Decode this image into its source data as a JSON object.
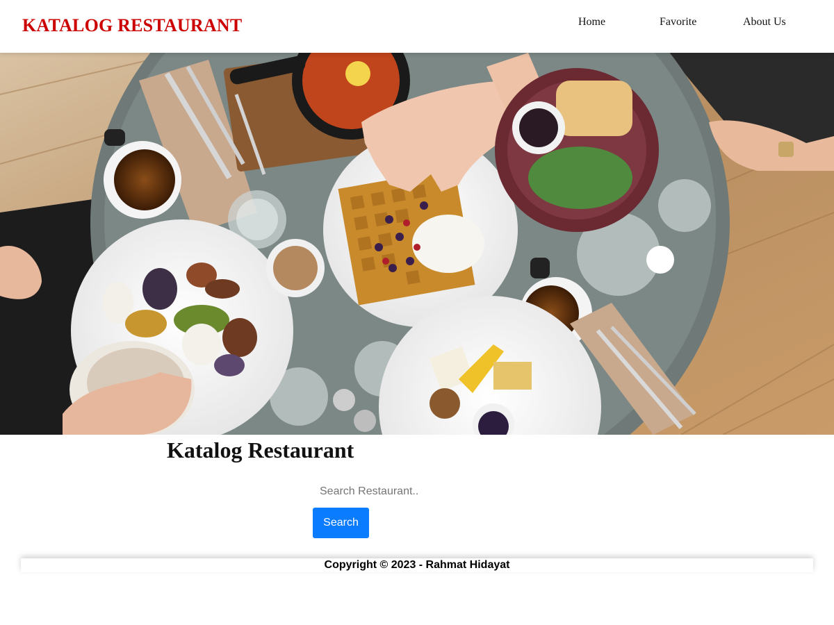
{
  "header": {
    "brand": "KATALOG RESTAURANT",
    "nav": {
      "home": "Home",
      "favorite": "Favorite",
      "about": "About Us"
    }
  },
  "hero": {
    "image_semantic": "restaurant-breakfast-table-photo"
  },
  "main": {
    "title": "Katalog Restaurant",
    "search": {
      "placeholder": "Search Restaurant..",
      "value": "",
      "button_label": "Search"
    }
  },
  "footer": {
    "copyright": "Copyright © 2023 - Rahmat Hidayat"
  },
  "colors": {
    "brand": "#cc0000",
    "button": "#0a7cff"
  }
}
